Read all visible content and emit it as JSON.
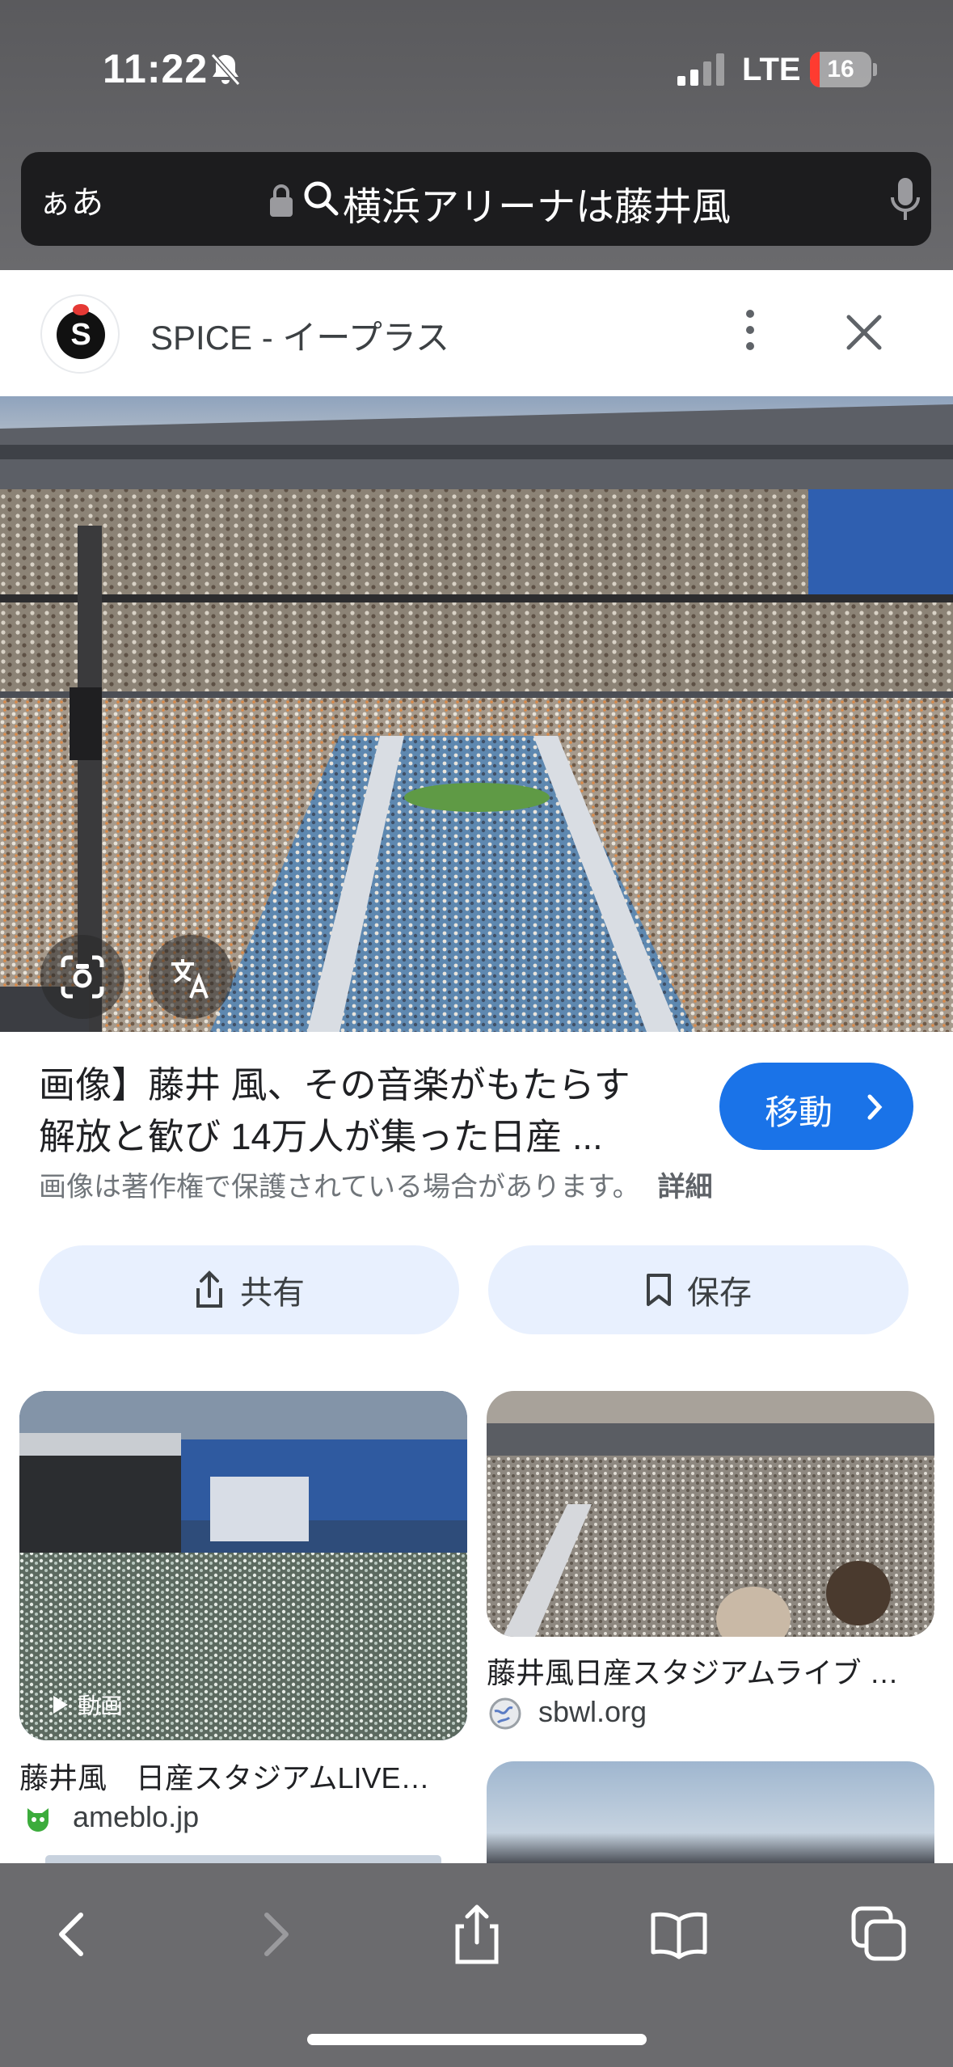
{
  "status_bar": {
    "time": "11:22",
    "network": "LTE",
    "battery_level": "16",
    "battery_fraction": 0.16
  },
  "address_bar": {
    "aa_label": "ぁあ",
    "query": "横浜アリーナは藤井風"
  },
  "source": {
    "name": "SPICE - イープラス"
  },
  "result": {
    "title_line1": "画像】藤井 風、その音楽がもたらす",
    "title_line2": "解放と歓び 14万人が集った日産 ...",
    "visit_label": "移動",
    "copyright": "画像は著作権で保護されている場合があります。",
    "details_label": "詳細",
    "share_label": "共有",
    "save_label": "保存"
  },
  "related": [
    {
      "title": "藤井風　日産スタジアムLIVE…",
      "source": "ameblo.jp",
      "badge": "動画"
    },
    {
      "title": "藤井風日産スタジアムライブ …",
      "source": "sbwl.org"
    }
  ],
  "icons": {
    "status": [
      "bell-slash-icon",
      "signal-icon",
      "battery-icon"
    ],
    "address": [
      "lock-icon",
      "search-icon",
      "microphone-icon"
    ],
    "header": [
      "more-vertical-icon",
      "close-icon"
    ],
    "image_tools": [
      "lens-icon",
      "translate-icon"
    ],
    "toolbar": [
      "back-icon",
      "forward-icon",
      "share-icon",
      "bookmarks-icon",
      "tabs-icon"
    ]
  },
  "colors": {
    "accent": "#1a73e8",
    "chip_background": "#e8f0fe",
    "battery_low": "#ff3b30"
  }
}
